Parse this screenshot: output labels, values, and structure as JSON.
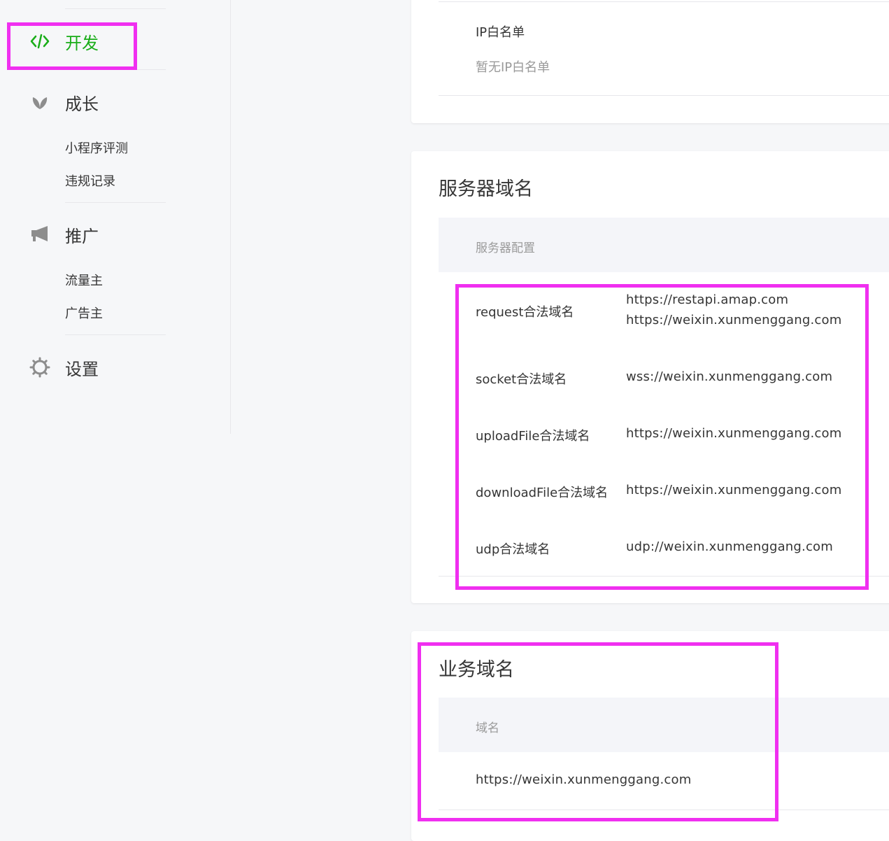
{
  "sidebar": {
    "active_item": {
      "icon": "code-icon",
      "label": "开发"
    },
    "groups": [
      {
        "icon": "sprout-icon",
        "label": "成长",
        "items": [
          "小程序评测",
          "违规记录"
        ]
      },
      {
        "icon": "megaphone-icon",
        "label": "推广",
        "items": [
          "流量主",
          "广告主"
        ]
      },
      {
        "icon": "gear-icon",
        "label": "设置",
        "items": []
      }
    ]
  },
  "ip_whitelist": {
    "label": "IP白名单",
    "value": "暂无IP白名单"
  },
  "server_domain": {
    "title": "服务器域名",
    "table_header": "服务器配置",
    "rows": [
      {
        "label": "request合法域名",
        "values": [
          "https://restapi.amap.com",
          "https://weixin.xunmenggang.com"
        ]
      },
      {
        "label": "socket合法域名",
        "values": [
          "wss://weixin.xunmenggang.com"
        ]
      },
      {
        "label": "uploadFile合法域名",
        "values": [
          "https://weixin.xunmenggang.com"
        ]
      },
      {
        "label": "downloadFile合法域名",
        "values": [
          "https://weixin.xunmenggang.com"
        ]
      },
      {
        "label": "udp合法域名",
        "values": [
          "udp://weixin.xunmenggang.com"
        ]
      }
    ]
  },
  "business_domain": {
    "title": "业务域名",
    "table_header": "域名",
    "value": "https://weixin.xunmenggang.com"
  },
  "colors": {
    "accent_green": "#1aad19",
    "annotation_magenta": "#f02ff0",
    "divider": "#e7e7eb"
  }
}
